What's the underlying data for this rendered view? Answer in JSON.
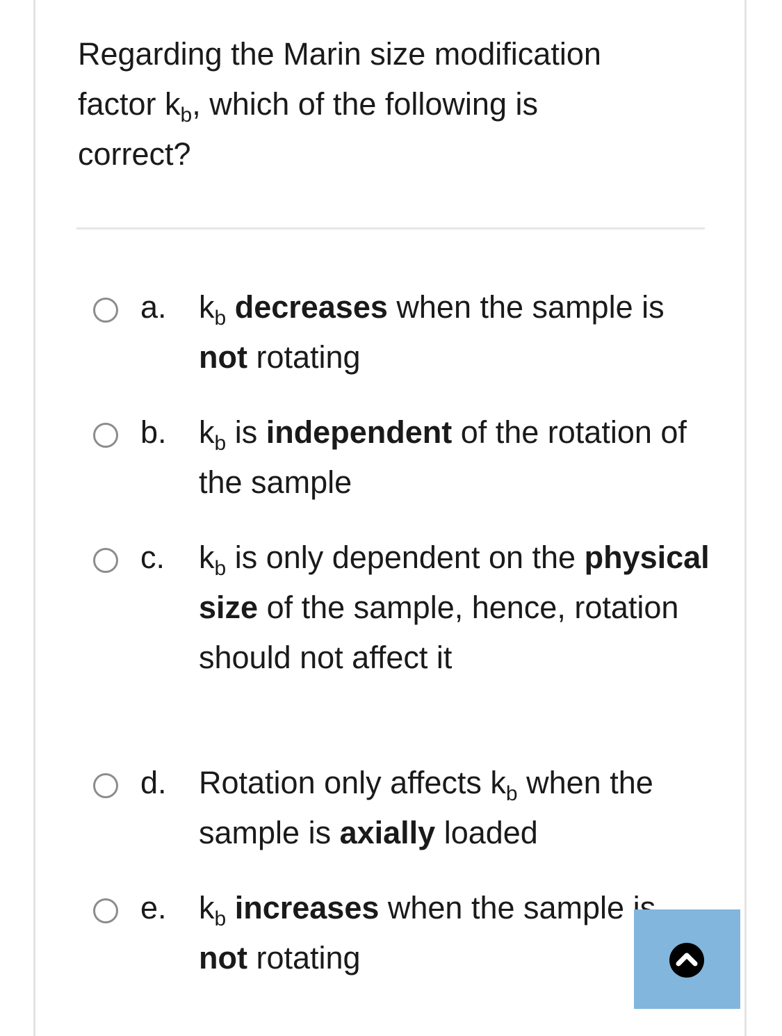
{
  "question": {
    "line1": "Regarding the Marin size modification",
    "line2_prefix": "factor k",
    "line2_sub": "b",
    "line2_suffix": ", which of the following is",
    "line3": "correct?"
  },
  "options": [
    {
      "letter": "a.",
      "k": "k",
      "sub": "b",
      "bold1": "decreases",
      "mid": " when the sample is",
      "bold2": "not",
      "end": " rotating"
    },
    {
      "letter": "b.",
      "k": "k",
      "sub": "b",
      "pre": " is ",
      "bold1": "independent",
      "end": " of the rotation of the sample"
    },
    {
      "letter": "c.",
      "k": "k",
      "sub": "b",
      "pre": " is only dependent on the ",
      "bold1": "physical size",
      "end": " of the sample, hence, rotation should not affect it"
    },
    {
      "letter": "d.",
      "pre": "Rotation only affects k",
      "sub": "b",
      "mid": " when the sample is ",
      "bold1": "axially",
      "end": " loaded"
    },
    {
      "letter": "e.",
      "k": "k",
      "sub": "b",
      "bold1": "increases",
      "mid": " when the sample is",
      "bold2": "not",
      "end": " rotating"
    }
  ],
  "icons": {
    "scroll_top": "chevron-up-circle-icon"
  },
  "colors": {
    "radio_border": "#8c8c8c",
    "scroll_button_bg": "#82b6dc",
    "divider": "#e6e6e6"
  }
}
